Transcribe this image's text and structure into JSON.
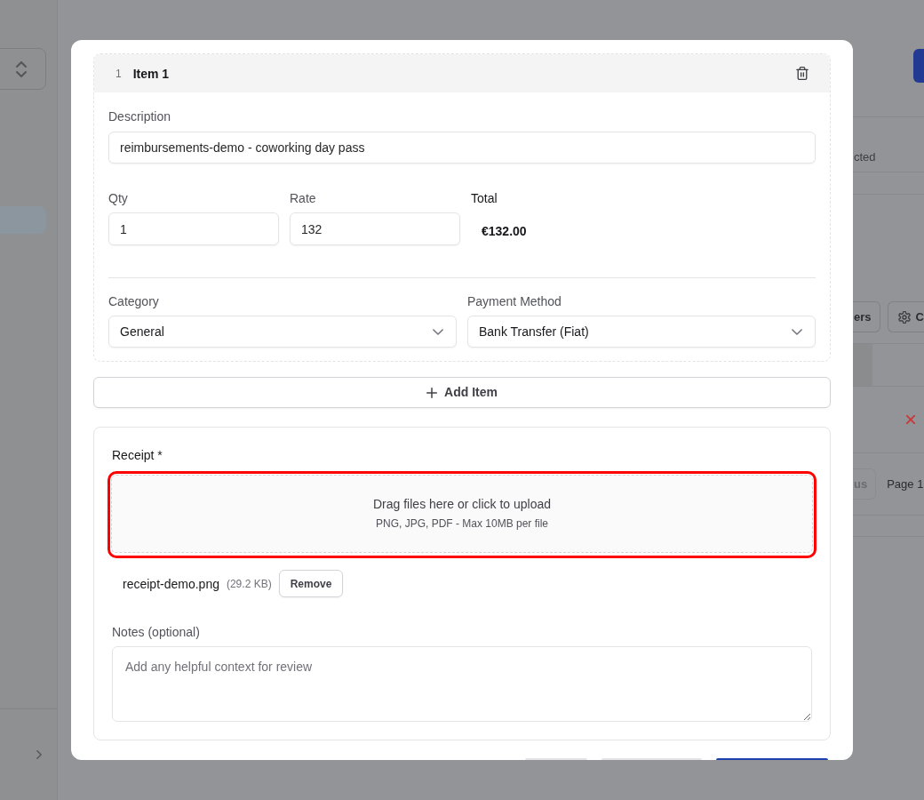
{
  "page": {
    "sidebar": {
      "items": [
        {
          "selected": true
        }
      ]
    },
    "selection_text": "cted",
    "toolbar": [
      {
        "kind": "plain",
        "label": "ers"
      },
      {
        "kind": "settings",
        "label": "C"
      }
    ],
    "pagination": {
      "previous": {
        "label": "us",
        "disabled": true
      },
      "page": "Page 1"
    }
  },
  "modal": {
    "items": [
      {
        "number": "1",
        "title": "Item 1",
        "description": {
          "label": "Description",
          "value": "reimbursements-demo - coworking day pass"
        },
        "qty": {
          "label": "Qty",
          "value": "1"
        },
        "rate": {
          "label": "Rate",
          "value": "132"
        },
        "total": {
          "label": "Total",
          "value": "€132.00"
        },
        "category": {
          "label": "Category",
          "value": "General"
        },
        "payment_method": {
          "label": "Payment Method",
          "value": "Bank Transfer (Fiat)"
        }
      }
    ],
    "add_item": "Add Item",
    "receipt": {
      "label": "Receipt *",
      "dropzone": {
        "title": "Drag files here or click to upload",
        "hint": "PNG, JPG, PDF - Max 10MB per file",
        "invalid": true
      },
      "files": [
        {
          "name": "receipt-demo.png",
          "size": "(29.2 KB)",
          "action": "Remove"
        }
      ],
      "notes": {
        "label": "Notes (optional)",
        "placeholder": "Add any helpful context for review"
      }
    },
    "footer_buttons": [
      {
        "kind": "outline"
      },
      {
        "kind": "outline"
      },
      {
        "kind": "primary"
      }
    ]
  }
}
